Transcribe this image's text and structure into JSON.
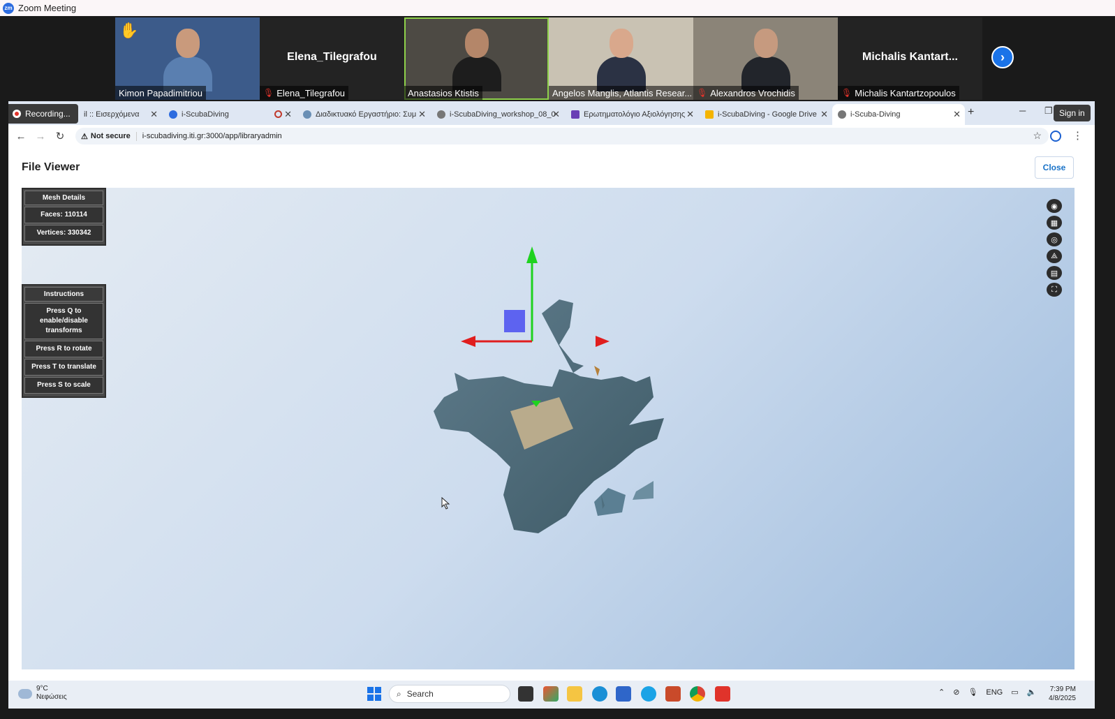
{
  "zoom": {
    "window_title": "Zoom Meeting",
    "logo_text": "zm"
  },
  "participants": [
    {
      "name": "Kimon Papadimitriou",
      "video": true,
      "muted": false,
      "hand_raised": true,
      "active": false
    },
    {
      "name": "Elena_Tilegrafou",
      "big_name": "Elena_Tilegrafou",
      "video": false,
      "muted": true,
      "hand_raised": false,
      "active": false
    },
    {
      "name": "Anastasios Ktistis",
      "video": true,
      "muted": false,
      "hand_raised": false,
      "active": true
    },
    {
      "name": "Angelos Manglis, Atlantis Resear...",
      "video": true,
      "muted": false,
      "hand_raised": false,
      "active": false
    },
    {
      "name": "Alexandros Vrochidis",
      "video": true,
      "muted": true,
      "hand_raised": false,
      "active": false
    },
    {
      "name": "Michalis Kantartzopoulos",
      "big_name": "Michalis  Kantart...",
      "video": false,
      "muted": true,
      "hand_raised": false,
      "active": false
    }
  ],
  "recording_label": "Recording...",
  "browser": {
    "tabs": [
      {
        "label": "il :: Εισερχόμενα"
      },
      {
        "label": "i-ScubaDiving"
      },
      {
        "label": "Διαδικτυακό Εργαστήριο: Συμ"
      },
      {
        "label": "i-ScubaDiving_workshop_08_0"
      },
      {
        "label": "Ερωτηματολόγιο Αξιολόγησης"
      },
      {
        "label": "i-ScubaDiving - Google Drive"
      },
      {
        "label": "i-Scuba-Diving",
        "active": true
      }
    ],
    "sign_in": "Sign in",
    "not_secure": "Not secure",
    "url": "i-scubadiving.iti.gr:3000/app/libraryadmin"
  },
  "page": {
    "title": "File Viewer",
    "close_label": "Close"
  },
  "mesh_details": {
    "header": "Mesh Details",
    "faces": "Faces: 110114",
    "vertices": "Vertices: 330342"
  },
  "instructions": {
    "header": "Instructions",
    "items": [
      "Press Q to enable/disable transforms",
      "Press R to rotate",
      "Press T to translate",
      "Press S to scale"
    ]
  },
  "viewer_tools": [
    "eye-icon",
    "grid-icon",
    "target-icon",
    "axes-icon",
    "table-icon",
    "fullscreen-icon"
  ],
  "taskbar": {
    "weather_temp": "9°C",
    "weather_desc": "Νεφώσεις",
    "search_placeholder": "Search",
    "lang": "ENG",
    "time": "7:39 PM",
    "date": "4/8/2025"
  }
}
